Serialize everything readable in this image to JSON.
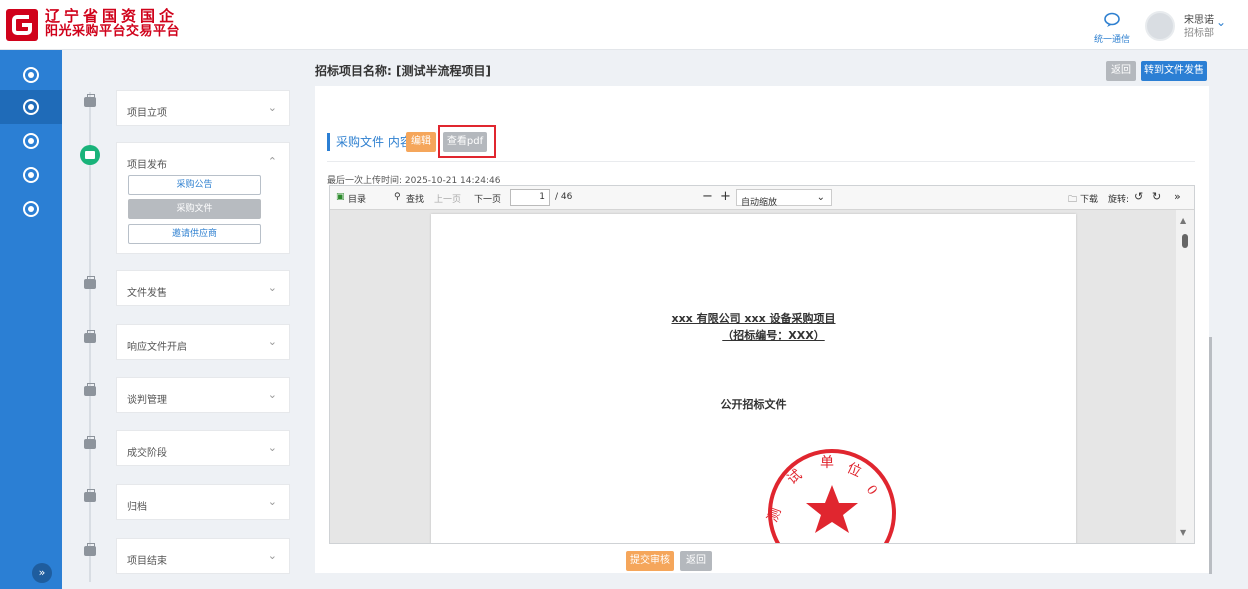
{
  "app": {
    "brand_line1": "辽宁省国资国企",
    "brand_line2": "阳光采购平台交易平台"
  },
  "header": {
    "message_label": "统一通信",
    "user_name": "宋思诺",
    "user_dept": "招标部"
  },
  "page": {
    "title": "招标项目名称: [测试半流程项目]",
    "back_label": "返回",
    "transfer_label": "转到文件发售"
  },
  "steps": [
    {
      "label": "项目立项"
    },
    {
      "label": "项目发布"
    },
    {
      "label": "文件发售"
    },
    {
      "label": "响应文件开启"
    },
    {
      "label": "谈判管理"
    },
    {
      "label": "成交阶段"
    },
    {
      "label": "归档"
    },
    {
      "label": "项目结束"
    }
  ],
  "substeps": [
    {
      "label": "采购公告"
    },
    {
      "label": "采购文件"
    },
    {
      "label": "邀请供应商"
    }
  ],
  "section": {
    "title": "采购文件 内容",
    "edit_label": "编辑",
    "view_pdf_label": "查看pdf",
    "upload_time": "最后一次上传时间: 2025-10-21 14:24:46"
  },
  "pdf": {
    "toc_label": "目录",
    "find_label": "查找",
    "prev_label": "上一页",
    "next_label": "下一页",
    "current_page": "1",
    "total_pages": "/ 46",
    "zoom": "自动缩放",
    "download_label": "下载",
    "rotate_label": "旋转:",
    "doc_line1": "xxx 有限公司 xxx 设备采购项目",
    "doc_line2": "（招标编号：XXX）",
    "doc_title": "公开招标文件",
    "seal_text": "测 试 单 位 0"
  },
  "footer": {
    "submit_label": "提交审核",
    "back_label": "返回"
  }
}
